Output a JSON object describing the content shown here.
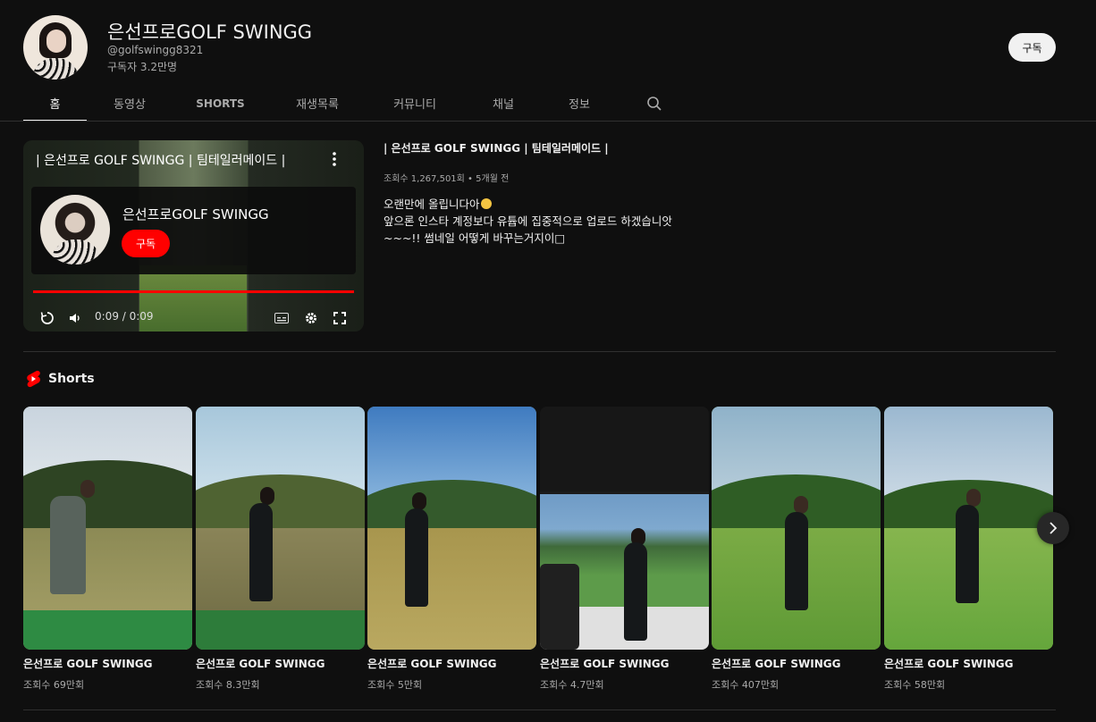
{
  "channel": {
    "name": "은선프로GOLF SWINGG",
    "handle": "@golfswingg8321",
    "subscribers": "구독자 3.2만명",
    "subscribe_label": "구독"
  },
  "tabs": [
    {
      "label": "홈",
      "active": true
    },
    {
      "label": "동영상"
    },
    {
      "label": "SHORTS"
    },
    {
      "label": "재생목록"
    },
    {
      "label": "커뮤니티"
    },
    {
      "label": "채널"
    },
    {
      "label": "정보"
    }
  ],
  "search_icon": "search-icon",
  "featured": {
    "player_title": "| 은선프로 GOLF SWINGG | 팀테일러메이드 |",
    "end_card_name": "은선프로GOLF SWINGG",
    "end_card_subscribe": "구독",
    "time": "0:09 / 0:09",
    "progress": 1.0,
    "title": "| 은선프로 GOLF SWINGG | 팀테일러메이드 |",
    "meta": "조회수 1,267,501회 • 5개월 전",
    "description": [
      "오랜만에 올립니다아",
      "앞으론 인스타 계정보다 유튭에 집중적으로 업로드 하겠습니앗",
      "~~~!! 썸네일 어떻게 바꾸는거지이□"
    ]
  },
  "shorts": {
    "title": "Shorts",
    "items": [
      {
        "title": "은선프로 GOLF SWINGG",
        "views": "조회수 69만회"
      },
      {
        "title": "은선프로 GOLF SWINGG",
        "views": "조회수 8.3만회"
      },
      {
        "title": "은선프로 GOLF SWINGG",
        "views": "조회수 5만회"
      },
      {
        "title": "은선프로 GOLF SWINGG",
        "views": "조회수 4.7만회"
      },
      {
        "title": "은선프로 GOLF SWINGG",
        "views": "조회수 407만회"
      },
      {
        "title": "은선프로 GOLF SWINGG",
        "views": "조회수 58만회"
      }
    ]
  },
  "colors": {
    "background": "#0f0f0f",
    "text": "#f1f1f1",
    "secondary_text": "#aaaaaa",
    "accent": "#ff0000"
  }
}
